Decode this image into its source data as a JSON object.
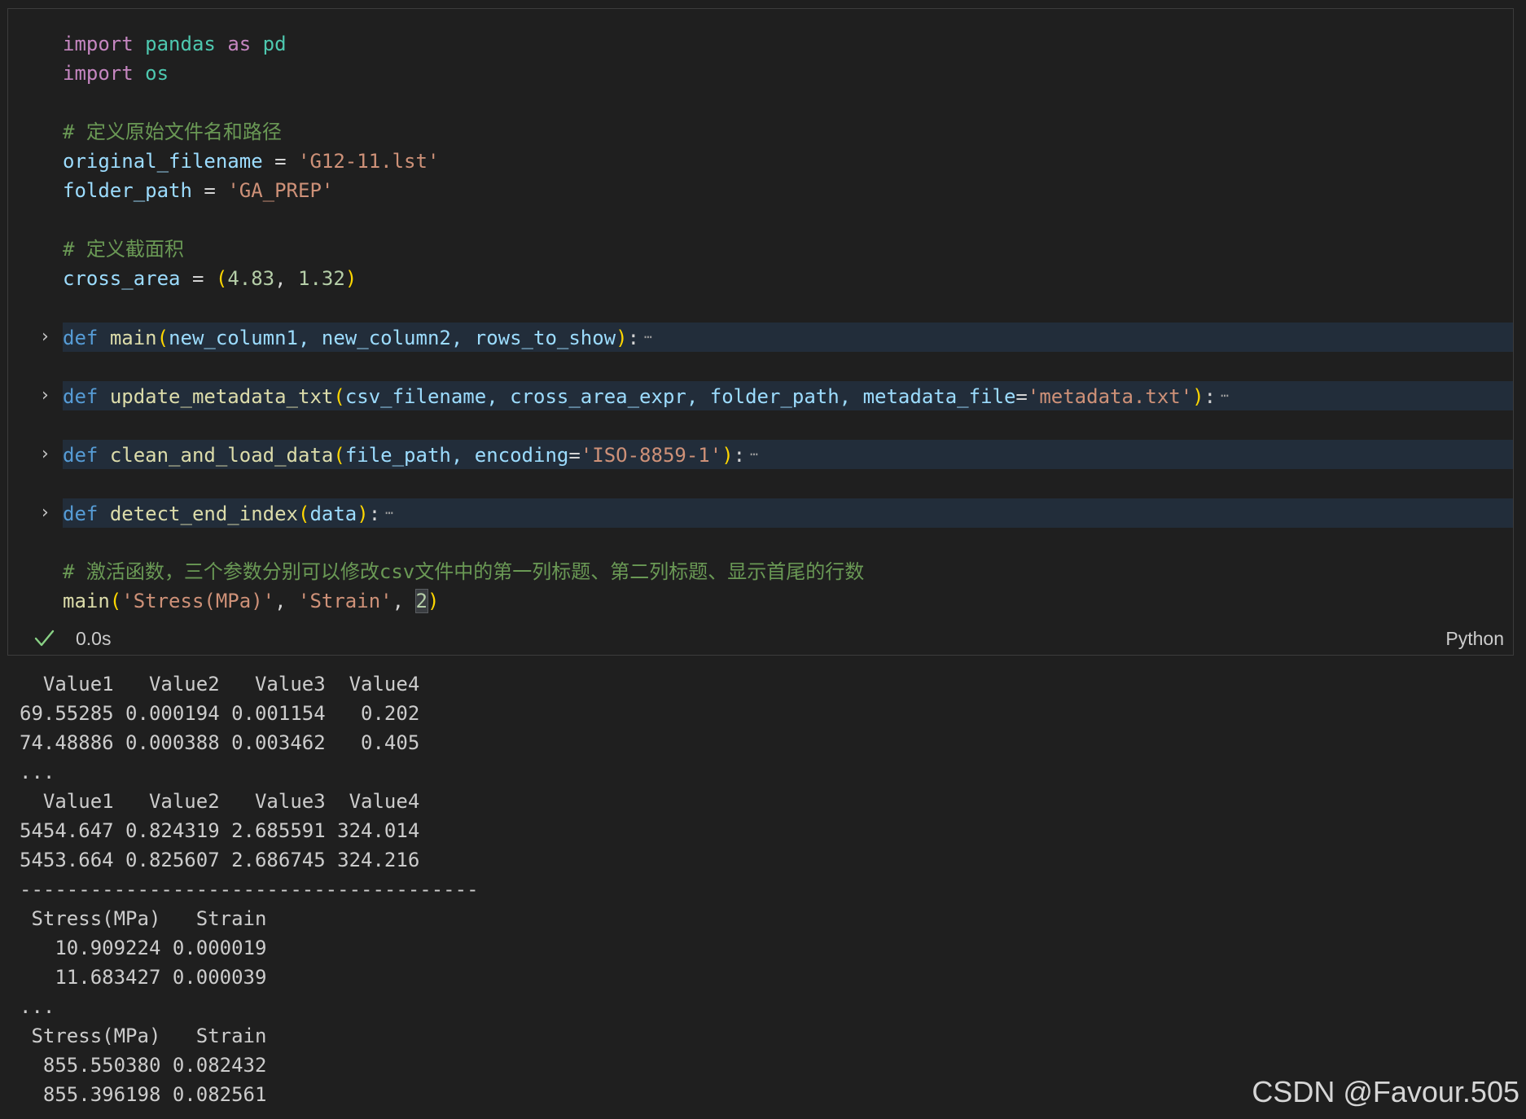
{
  "code": {
    "import1": {
      "kw": "import",
      "module": "pandas",
      "as": "as",
      "alias": "pd"
    },
    "import2": {
      "kw": "import",
      "module": "os"
    },
    "comment1": "# 定义原始文件名和路径",
    "assign1": {
      "name": "original_filename",
      "op": " = ",
      "value": "'G12-11.lst'"
    },
    "assign2": {
      "name": "folder_path",
      "op": " = ",
      "value": "'GA_PREP'"
    },
    "comment2": "# 定义截面积",
    "assign3": {
      "name": "cross_area",
      "op": " = ",
      "open": "(",
      "n1": "4.83",
      "sep": ", ",
      "n2": "1.32",
      "close": ")"
    },
    "def_main": {
      "kw": "def",
      "name": "main",
      "open": "(",
      "params": "new_column1, new_column2, rows_to_show",
      "close": ")",
      "colon": ":"
    },
    "def_update": {
      "kw": "def",
      "name": "update_metadata_txt",
      "open": "(",
      "params": "csv_filename, cross_area_expr, folder_path, metadata_file",
      "eq": "=",
      "default": "'metadata.txt'",
      "close": ")",
      "colon": ":"
    },
    "def_clean": {
      "kw": "def",
      "name": "clean_and_load_data",
      "open": "(",
      "params": "file_path, encoding",
      "eq": "=",
      "default": "'ISO-8859-1'",
      "close": ")",
      "colon": ":"
    },
    "def_detect": {
      "kw": "def",
      "name": "detect_end_index",
      "open": "(",
      "params": "data",
      "close": ")",
      "colon": ":"
    },
    "comment3": "# 激活函数，三个参数分别可以修改csv文件中的第一列标题、第二列标题、显示首尾的行数",
    "call": {
      "name": "main",
      "open": "(",
      "a1": "'Stress(MPa)'",
      "sep1": ", ",
      "a2": "'Strain'",
      "sep2": ", ",
      "a3": "2",
      "close": ")"
    },
    "ellipsis": "⋯",
    "chevron": "›"
  },
  "status": {
    "check_icon": "check-icon",
    "time": "0.0s",
    "language": "Python"
  },
  "output_lines": [
    "  Value1   Value2   Value3  Value4",
    "69.55285 0.000194 0.001154   0.202",
    "74.48886 0.000388 0.003462   0.405",
    "...",
    "  Value1   Value2   Value3  Value4",
    "5454.647 0.824319 2.685591 324.014",
    "5453.664 0.825607 2.686745 324.216",
    "---------------------------------------",
    " Stress(MPa)   Strain",
    "   10.909224 0.000019",
    "   11.683427 0.000039",
    "...",
    " Stress(MPa)   Strain",
    "  855.550380 0.082432",
    "  855.396198 0.082561"
  ],
  "watermark": "CSDN @Favour.505",
  "colors": {
    "background": "#1f1f1f",
    "keyword": "#c586c0",
    "def": "#569cd6",
    "module": "#4ec9b0",
    "variable": "#9cdcfe",
    "function": "#dcdcaa",
    "string": "#ce9178",
    "number": "#b5cea8",
    "comment": "#6a9955",
    "success": "#89d185"
  }
}
